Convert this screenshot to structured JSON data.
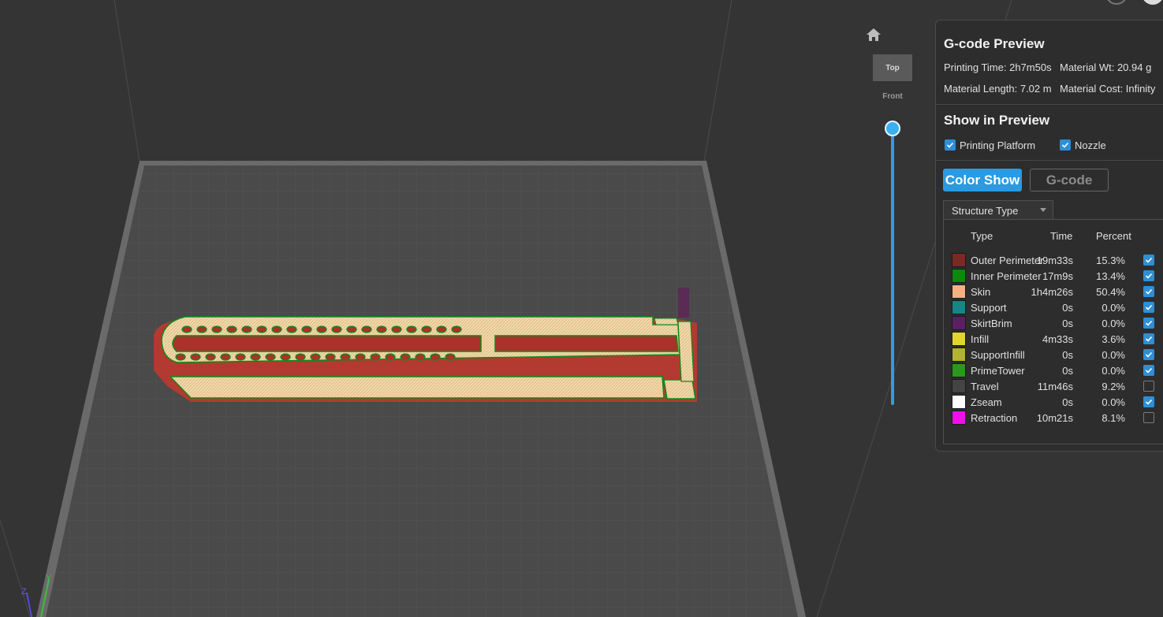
{
  "view": {
    "home_icon": "home-icon",
    "top_label": "Top",
    "front_label": "Front"
  },
  "gcode_preview": {
    "title": "G-code Preview",
    "printing_time": "Printing Time: 2h7m50s",
    "material_wt": "Material Wt: 20.94 g",
    "material_length": "Material Length: 7.02 m",
    "material_cost": "Material Cost: Infinity"
  },
  "show_in_preview": {
    "title": "Show in Preview",
    "printing_platform": {
      "label": "Printing Platform",
      "checked": true
    },
    "nozzle": {
      "label": "Nozzle",
      "checked": true
    }
  },
  "mode_buttons": {
    "color_show": "Color Show",
    "gcode": "G-code"
  },
  "structure": {
    "dropdown_value": "Structure Type",
    "headers": {
      "type": "Type",
      "time": "Time",
      "percent": "Percent"
    },
    "rows": [
      {
        "type": "Outer Perimeter",
        "time": "19m33s",
        "percent": "15.3%",
        "color": "#7a2a24",
        "checked": true
      },
      {
        "type": "Inner Perimeter",
        "time": "17m9s",
        "percent": "13.4%",
        "color": "#0a8a10",
        "checked": true
      },
      {
        "type": "Skin",
        "time": "1h4m26s",
        "percent": "50.4%",
        "color": "#f4b184",
        "checked": true
      },
      {
        "type": "Support",
        "time": "0s",
        "percent": "0.0%",
        "color": "#178585",
        "checked": true
      },
      {
        "type": "SkirtBrim",
        "time": "0s",
        "percent": "0.0%",
        "color": "#5a2060",
        "checked": true
      },
      {
        "type": "Infill",
        "time": "4m33s",
        "percent": "3.6%",
        "color": "#e2d42e",
        "checked": true
      },
      {
        "type": "SupportInfill",
        "time": "0s",
        "percent": "0.0%",
        "color": "#b0b432",
        "checked": true
      },
      {
        "type": "PrimeTower",
        "time": "0s",
        "percent": "0.0%",
        "color": "#2e9620",
        "checked": true
      },
      {
        "type": "Travel",
        "time": "11m46s",
        "percent": "9.2%",
        "color": "#444444",
        "checked": false
      },
      {
        "type": "Zseam",
        "time": "0s",
        "percent": "0.0%",
        "color": "#ffffff",
        "checked": true
      },
      {
        "type": "Retraction",
        "time": "10m21s",
        "percent": "8.1%",
        "color": "#ee10e6",
        "checked": false
      }
    ]
  },
  "colors": {
    "accent": "#2a9ae2",
    "background": "#343434",
    "bed": "#4a4a4a",
    "bed_frame": "#707070"
  }
}
